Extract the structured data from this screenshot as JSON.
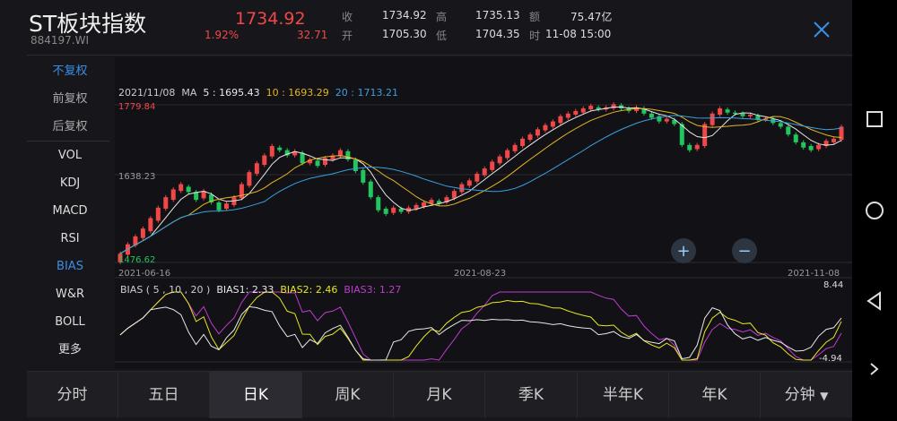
{
  "header": {
    "title": "ST板块指数",
    "code": "884197.WI",
    "price": "1734.92",
    "change_pct": "1.92%",
    "change": "32.71",
    "stats": [
      {
        "k": "收",
        "v": "1734.92"
      },
      {
        "k": "开",
        "v": "1705.30"
      },
      {
        "k": "高",
        "v": "1735.13"
      },
      {
        "k": "低",
        "v": "1704.35"
      },
      {
        "k": "额",
        "v": "75.47亿"
      },
      {
        "k": "时",
        "v": "11-08 15:00"
      }
    ]
  },
  "menu": {
    "items": [
      "不复权",
      "前复权",
      "后复权",
      "VOL",
      "KDJ",
      "MACD",
      "RSI",
      "BIAS",
      "W&R",
      "BOLL",
      "更多"
    ]
  },
  "ma_legend": {
    "date": "2021/11/08",
    "label": "MA",
    "ma5": "5 : 1695.43",
    "ma10": "10 : 1693.29",
    "ma20": "20 : 1713.21"
  },
  "bias_legend": {
    "label": "BIAS ( 5 , 10 , 20 )",
    "b1": "BIAS1: 2.33",
    "b2": "BIAS2: 2.46",
    "b3": "BIAS3: 1.27"
  },
  "tabs": [
    "分时",
    "五日",
    "日K",
    "周K",
    "月K",
    "季K",
    "半年K",
    "年K",
    "分钟"
  ],
  "colors": {
    "up": "#f04848",
    "down": "#22c55e",
    "ma5": "#e8e8e8",
    "ma10": "#e6b422",
    "ma20": "#3aa0e0",
    "bias3": "#c03ad0",
    "accent": "#3a8ee6"
  },
  "chart_data": {
    "type": "candlestick",
    "price_max_label": "1779.84",
    "price_mid_label": "1638.23",
    "price_min_label": "1476.62",
    "x_labels": [
      "2021-06-16",
      "2021-08-23",
      "2021-11-08"
    ],
    "bias_max_label": "8.44",
    "bias_min_label": "-4.94",
    "candles": [
      [
        1476,
        1492
      ],
      [
        1490,
        1510
      ],
      [
        1508,
        1525
      ],
      [
        1522,
        1540
      ],
      [
        1535,
        1560
      ],
      [
        1555,
        1580
      ],
      [
        1578,
        1600
      ],
      [
        1595,
        1615
      ],
      [
        1612,
        1625
      ],
      [
        1620,
        1610
      ],
      [
        1610,
        1595
      ],
      [
        1598,
        1612
      ],
      [
        1605,
        1590
      ],
      [
        1590,
        1575
      ],
      [
        1578,
        1588
      ],
      [
        1585,
        1600
      ],
      [
        1598,
        1625
      ],
      [
        1622,
        1648
      ],
      [
        1645,
        1665
      ],
      [
        1662,
        1680
      ],
      [
        1678,
        1698
      ],
      [
        1695,
        1690
      ],
      [
        1690,
        1680
      ],
      [
        1680,
        1688
      ],
      [
        1685,
        1665
      ],
      [
        1665,
        1672
      ],
      [
        1670,
        1660
      ],
      [
        1662,
        1675
      ],
      [
        1672,
        1680
      ],
      [
        1678,
        1690
      ],
      [
        1688,
        1672
      ],
      [
        1672,
        1650
      ],
      [
        1652,
        1628
      ],
      [
        1630,
        1600
      ],
      [
        1600,
        1575
      ],
      [
        1578,
        1568
      ],
      [
        1570,
        1580
      ],
      [
        1578,
        1572
      ],
      [
        1572,
        1580
      ],
      [
        1578,
        1585
      ],
      [
        1582,
        1590
      ],
      [
        1588,
        1595
      ],
      [
        1593,
        1588
      ],
      [
        1590,
        1600
      ],
      [
        1598,
        1612
      ],
      [
        1610,
        1625
      ],
      [
        1622,
        1632
      ],
      [
        1630,
        1645
      ],
      [
        1642,
        1655
      ],
      [
        1652,
        1668
      ],
      [
        1665,
        1678
      ],
      [
        1675,
        1690
      ],
      [
        1688,
        1700
      ],
      [
        1698,
        1712
      ],
      [
        1710,
        1720
      ],
      [
        1718,
        1730
      ],
      [
        1728,
        1738
      ],
      [
        1735,
        1745
      ],
      [
        1742,
        1755
      ],
      [
        1752,
        1760
      ],
      [
        1758,
        1765
      ],
      [
        1762,
        1770
      ],
      [
        1768,
        1775
      ],
      [
        1772,
        1768
      ],
      [
        1768,
        1772
      ],
      [
        1770,
        1778
      ],
      [
        1776,
        1770
      ],
      [
        1770,
        1765
      ],
      [
        1765,
        1772
      ],
      [
        1770,
        1760
      ],
      [
        1760,
        1752
      ],
      [
        1755,
        1745
      ],
      [
        1745,
        1750
      ],
      [
        1748,
        1740
      ],
      [
        1740,
        1700
      ],
      [
        1700,
        1690
      ],
      [
        1692,
        1700
      ],
      [
        1698,
        1740
      ],
      [
        1738,
        1760
      ],
      [
        1758,
        1770
      ],
      [
        1768,
        1762
      ],
      [
        1762,
        1760
      ],
      [
        1760,
        1755
      ],
      [
        1755,
        1758
      ],
      [
        1756,
        1748
      ],
      [
        1748,
        1750
      ],
      [
        1750,
        1742
      ],
      [
        1742,
        1735
      ],
      [
        1735,
        1720
      ],
      [
        1720,
        1705
      ],
      [
        1705,
        1695
      ],
      [
        1698,
        1690
      ],
      [
        1692,
        1700
      ],
      [
        1698,
        1708
      ],
      [
        1705,
        1712
      ],
      [
        1710,
        1735
      ]
    ]
  }
}
